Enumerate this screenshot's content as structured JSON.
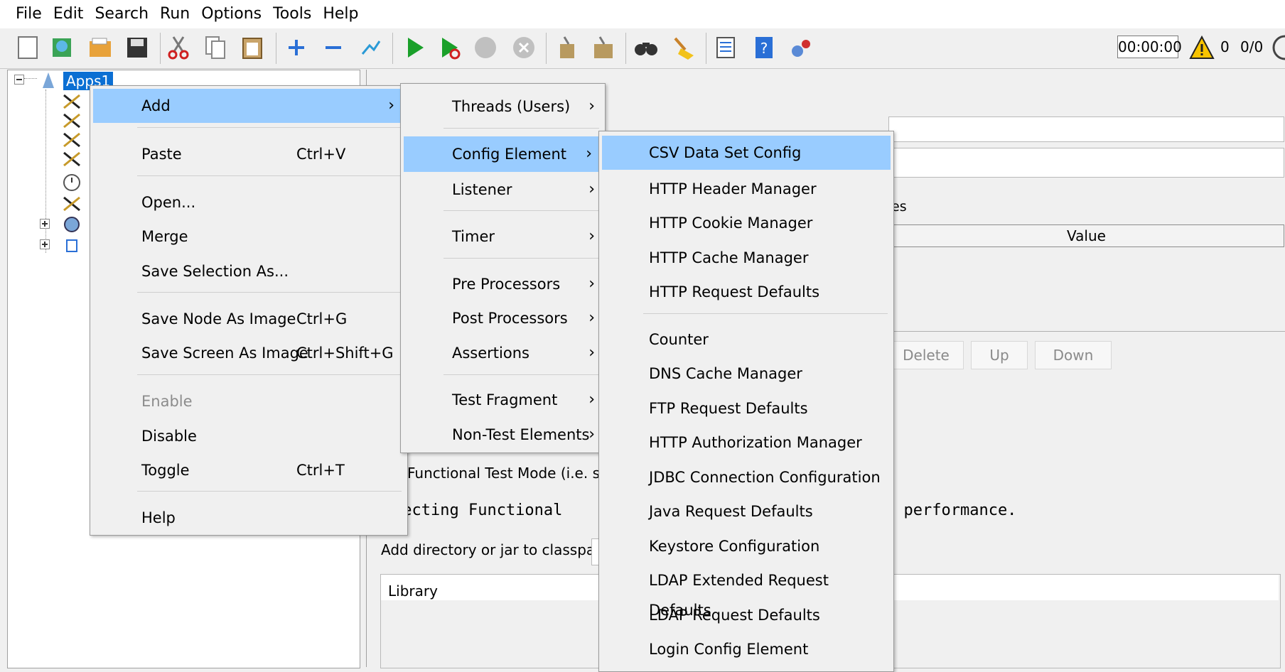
{
  "menubar": [
    "File",
    "Edit",
    "Search",
    "Run",
    "Options",
    "Tools",
    "Help"
  ],
  "toolbar": {
    "icons": [
      "new-icon",
      "templates-icon",
      "open-icon",
      "save-icon",
      "cut-icon",
      "copy-icon",
      "paste-icon",
      "expand-icon",
      "collapse-icon",
      "toggle-icon",
      "start-icon",
      "start-no-pauses-icon",
      "stop-icon",
      "shutdown-icon",
      "clear-icon",
      "clear-all-icon",
      "search-icon",
      "reset-search-icon",
      "function-helper-icon",
      "help-icon",
      "remote-icon"
    ],
    "timer": "00:00:00",
    "warnings": "0",
    "threads": "0/0"
  },
  "tree": {
    "root": "Apps1"
  },
  "context_menu": {
    "items": [
      {
        "label": "Add",
        "submenu": true,
        "selected": true
      },
      {
        "label": "Paste",
        "shortcut": "Ctrl+V"
      },
      {
        "label": "Open..."
      },
      {
        "label": "Merge"
      },
      {
        "label": "Save Selection As..."
      },
      {
        "label": "Save Node As Image",
        "shortcut": "Ctrl+G"
      },
      {
        "label": "Save Screen As Image",
        "shortcut": "Ctrl+Shift+G"
      },
      {
        "label": "Enable",
        "disabled": true
      },
      {
        "label": "Disable"
      },
      {
        "label": "Toggle",
        "shortcut": "Ctrl+T"
      },
      {
        "label": "Help"
      }
    ]
  },
  "add_menu": {
    "items": [
      {
        "label": "Threads (Users)"
      },
      {
        "label": "Config Element",
        "selected": true
      },
      {
        "label": "Listener"
      },
      {
        "label": "Timer"
      },
      {
        "label": "Pre Processors"
      },
      {
        "label": "Post Processors"
      },
      {
        "label": "Assertions"
      },
      {
        "label": "Test Fragment"
      },
      {
        "label": "Non-Test Elements"
      }
    ]
  },
  "config_menu": {
    "items": [
      {
        "label": "CSV Data Set Config",
        "selected": true
      },
      {
        "label": "HTTP Header Manager"
      },
      {
        "label": "HTTP Cookie Manager"
      },
      {
        "label": "HTTP Cache Manager"
      },
      {
        "label": "HTTP Request Defaults"
      },
      {
        "label": "Counter"
      },
      {
        "label": "DNS Cache Manager"
      },
      {
        "label": "FTP Request Defaults"
      },
      {
        "label": "HTTP Authorization Manager"
      },
      {
        "label": "JDBC Connection Configuration"
      },
      {
        "label": "Java Request Defaults"
      },
      {
        "label": "Keystore Configuration"
      },
      {
        "label": "LDAP Extended Request Defaults"
      },
      {
        "label": "LDAP Request Defaults"
      },
      {
        "label": "Login Config Element"
      }
    ]
  },
  "right_panel": {
    "variables_fragment": "es",
    "value_column": "Value",
    "buttons": [
      "Delete",
      "Up",
      "Down"
    ],
    "functional_mode": "Functional Test Mode (i.e. sav",
    "mono_left": "lecting Functional",
    "mono_right": "t performance.",
    "classpath_label": "Add directory or jar to classpath",
    "library_header": "Library"
  }
}
